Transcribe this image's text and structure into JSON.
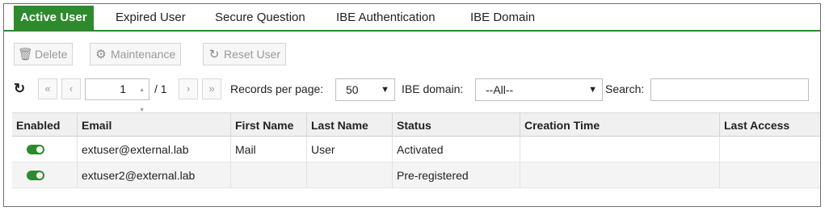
{
  "tabs": [
    {
      "label": "Active User",
      "active": true
    },
    {
      "label": "Expired User",
      "active": false
    },
    {
      "label": "Secure Question",
      "active": false
    },
    {
      "label": "IBE Authentication",
      "active": false
    },
    {
      "label": "IBE Domain",
      "active": false
    }
  ],
  "toolbar": {
    "delete_label": "Delete",
    "maintenance_label": "Maintenance",
    "reset_user_label": "Reset User",
    "delete_icon": "trash-icon",
    "maintenance_icon": "gear-icon",
    "reset_icon": "refresh-icon"
  },
  "pager": {
    "current_page": "1",
    "total_pages": "/ 1",
    "records_per_page_label": "Records per page:",
    "records_per_page_value": "50",
    "ibe_domain_label": "IBE domain:",
    "ibe_domain_value": "--All--",
    "search_label": "Search:",
    "search_value": ""
  },
  "table": {
    "columns": [
      "Enabled",
      "Email",
      "First Name",
      "Last Name",
      "Status",
      "Creation Time",
      "Last Access"
    ],
    "rows": [
      {
        "enabled": true,
        "email": "extuser@external.lab",
        "first_name": "Mail",
        "last_name": "User",
        "status": "Activated",
        "creation_time": "",
        "last_access": ""
      },
      {
        "enabled": true,
        "email": "extuser2@external.lab",
        "first_name": "",
        "last_name": "",
        "status": "Pre-registered",
        "creation_time": "",
        "last_access": ""
      }
    ]
  },
  "colors": {
    "accent": "#2d8a2d",
    "header_bg": "#f0f0f0",
    "disabled_text": "#9a9a9a"
  }
}
